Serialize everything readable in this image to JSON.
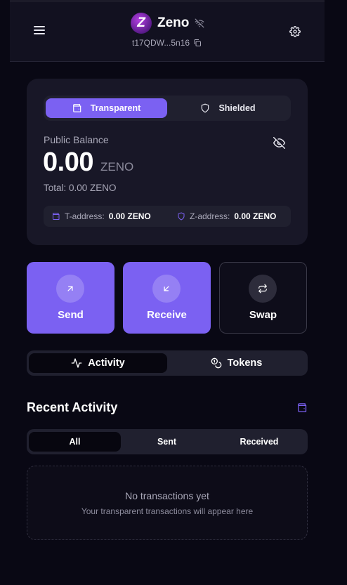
{
  "header": {
    "app_name": "Zeno",
    "logo_letter": "Z",
    "address_short": "t17QDW...5n16",
    "icons": {
      "menu": "menu-icon",
      "connection": "wifi-off-icon",
      "copy": "copy-icon",
      "settings": "gear-icon"
    }
  },
  "balance": {
    "modes": [
      {
        "label": "Transparent",
        "icon": "wallet-icon",
        "active": true
      },
      {
        "label": "Shielded",
        "icon": "shield-icon",
        "active": false
      }
    ],
    "label": "Public Balance",
    "amount": "0.00",
    "unit": "ZENO",
    "total": "Total: 0.00 ZENO",
    "addresses": [
      {
        "key": "T-address:",
        "value": "0.00 ZENO",
        "icon": "wallet-icon"
      },
      {
        "key": "Z-address:",
        "value": "0.00 ZENO",
        "icon": "shield-icon"
      }
    ]
  },
  "actions": [
    {
      "label": "Send",
      "icon": "arrow-up-right-icon"
    },
    {
      "label": "Receive",
      "icon": "arrow-down-left-icon"
    },
    {
      "label": "Swap",
      "icon": "swap-icon"
    }
  ],
  "main_tabs": [
    {
      "label": "Activity",
      "icon": "activity-icon",
      "active": true
    },
    {
      "label": "Tokens",
      "icon": "coins-icon",
      "active": false
    }
  ],
  "recent": {
    "title": "Recent Activity",
    "filters": [
      {
        "label": "All",
        "active": true
      },
      {
        "label": "Sent",
        "active": false
      },
      {
        "label": "Received",
        "active": false
      }
    ],
    "empty_title": "No transactions yet",
    "empty_subtitle": "Your transparent transactions will appear here"
  },
  "colors": {
    "accent": "#7b61f2",
    "background": "#090814",
    "card": "#181727",
    "muted_text": "#a9a8b8"
  }
}
